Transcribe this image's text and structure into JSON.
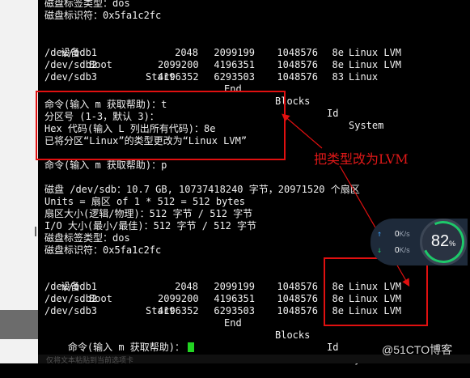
{
  "terminal": {
    "label_type": "磁盘标签类型：dos",
    "label_id": "磁盘标识符：0x5fa1c2fc",
    "table_header": {
      "device": "设备",
      "boot": "Boot",
      "start": "Start",
      "end": "End",
      "blocks": "Blocks",
      "id": "Id",
      "system": "System"
    },
    "table1": [
      {
        "device": "/dev/sdb1",
        "start": "2048",
        "end": "2099199",
        "blocks": "1048576",
        "id": "8e",
        "system": "Linux LVM"
      },
      {
        "device": "/dev/sdb2",
        "start": "2099200",
        "end": "4196351",
        "blocks": "1048576",
        "id": "8e",
        "system": "Linux LVM"
      },
      {
        "device": "/dev/sdb3",
        "start": "4196352",
        "end": "6293503",
        "blocks": "1048576",
        "id": "83",
        "system": "Linux"
      }
    ],
    "cmd_t": "命令(输入 m 获取帮助)：t",
    "partition_prompt": "分区号 (1-3，默认 3)：",
    "hex_prompt": "Hex 代码(输入 L 列出所有代码)：8e",
    "changed_msg": "已将分区“Linux”的类型更改为“Linux LVM”",
    "cmd_p": "命令(输入 m 获取帮助)：p",
    "disk_info": "磁盘 /dev/sdb：10.7 GB, 10737418240 字节，20971520 个扇区",
    "units": "Units = 扇区 of 1 * 512 = 512 bytes",
    "sector_size": "扇区大小(逻辑/物理)：512 字节 / 512 字节",
    "io_size": "I/O 大小(最小/最佳)：512 字节 / 512 字节",
    "label_type2": "磁盘标签类型：dos",
    "label_id2": "磁盘标识符：0x5fa1c2fc",
    "table2": [
      {
        "device": "/dev/sdb1",
        "start": "2048",
        "end": "2099199",
        "blocks": "1048576",
        "id": "8e",
        "system": "Linux LVM"
      },
      {
        "device": "/dev/sdb2",
        "start": "2099200",
        "end": "4196351",
        "blocks": "1048576",
        "id": "8e",
        "system": "Linux LVM"
      },
      {
        "device": "/dev/sdb3",
        "start": "4196352",
        "end": "6293503",
        "blocks": "1048576",
        "id": "8e",
        "system": "Linux LVM"
      }
    ],
    "final_prompt": "命令(输入 m 获取帮助)："
  },
  "annotation": {
    "text": "把类型改为LVM",
    "color": "#e01010"
  },
  "net_widget": {
    "upload": "0",
    "download": "0",
    "unit": "K/s",
    "load_percent": "82",
    "percent_sign": "%",
    "accent": "#1ec86a"
  },
  "watermark": "@51CTO博客",
  "bottom_text": "仅将文本粘贴到当前选项卡"
}
